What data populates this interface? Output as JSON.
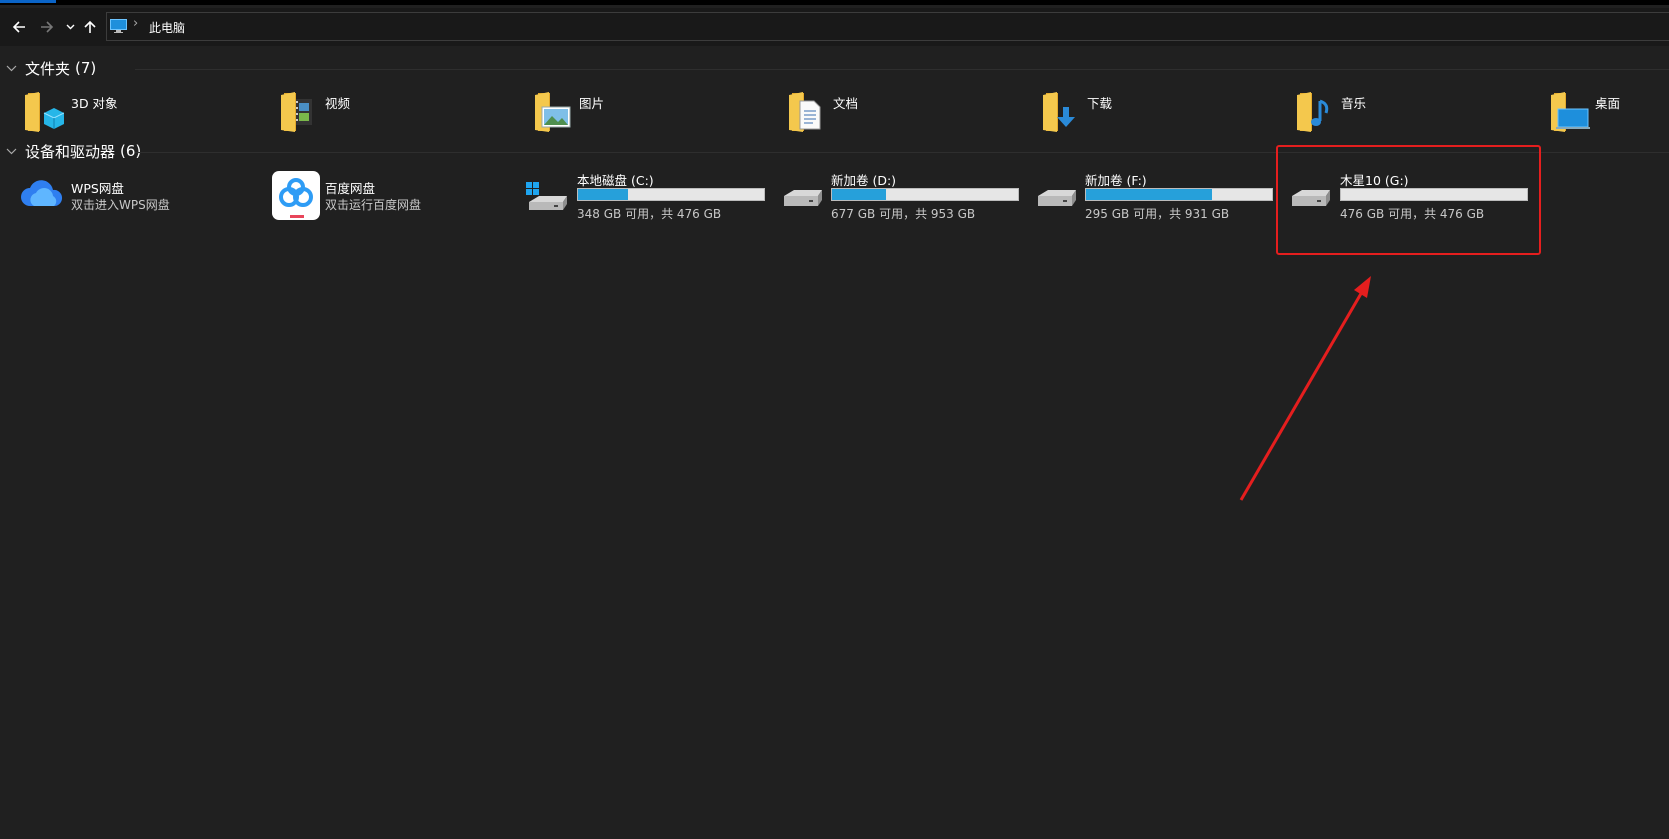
{
  "window": {
    "accent_color": "#0a64c8"
  },
  "navigation": {
    "back_icon": "arrow-left-icon",
    "forward_icon": "arrow-right-icon",
    "recent_icon": "chevron-down-icon",
    "up_icon": "arrow-up-icon"
  },
  "address": {
    "location_icon": "this-pc-icon",
    "separator": "›",
    "location": "此电脑"
  },
  "folders_group": {
    "title": "文件夹",
    "count": "(7)"
  },
  "folders": [
    {
      "name": "3D 对象",
      "icon": "3d-objects-folder-icon"
    },
    {
      "name": "视频",
      "icon": "videos-folder-icon"
    },
    {
      "name": "图片",
      "icon": "pictures-folder-icon"
    },
    {
      "name": "文档",
      "icon": "documents-folder-icon"
    },
    {
      "name": "下载",
      "icon": "downloads-folder-icon"
    },
    {
      "name": "音乐",
      "icon": "music-folder-icon"
    },
    {
      "name": "桌面",
      "icon": "desktop-folder-icon"
    }
  ],
  "devices_group": {
    "title": "设备和驱动器",
    "count": "(6)"
  },
  "apps": [
    {
      "name": "WPS网盘",
      "sub": "双击进入WPS网盘",
      "icon": "wps-cloud-icon"
    },
    {
      "name": "百度网盘",
      "sub": "双击运行百度网盘",
      "icon": "baidu-netdisk-icon"
    }
  ],
  "drives": [
    {
      "name": "本地磁盘 (C:)",
      "sub": "348 GB 可用，共 476 GB",
      "used_fraction": 0.27,
      "icon": "windows-drive-icon"
    },
    {
      "name": "新加卷 (D:)",
      "sub": "677 GB 可用，共 953 GB",
      "used_fraction": 0.29,
      "icon": "hard-drive-icon"
    },
    {
      "name": "新加卷 (F:)",
      "sub": "295 GB 可用，共 931 GB",
      "used_fraction": 0.68,
      "icon": "hard-drive-icon"
    },
    {
      "name": "木星10 (G:)",
      "sub": "476 GB 可用，共 476 GB",
      "used_fraction": 0.0,
      "icon": "hard-drive-icon"
    }
  ],
  "annotation": {
    "color": "#e51e1e",
    "target": "木星10 (G:)"
  },
  "colors": {
    "background": "#202020",
    "bar_fill": "#26a0da",
    "bar_track": "#e6e6e6",
    "folder": "#f4c84d"
  }
}
